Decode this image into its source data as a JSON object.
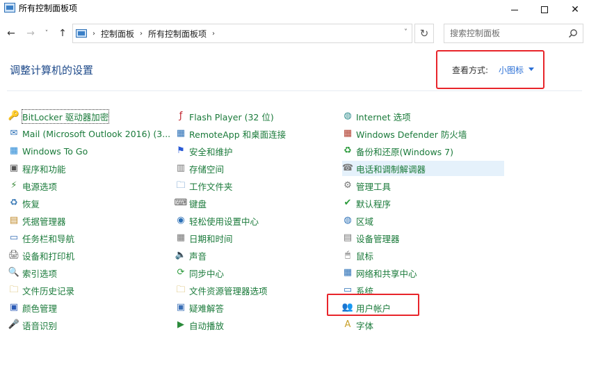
{
  "window": {
    "title": "所有控制面板项",
    "minimize_glyph": "",
    "maximize_glyph": "",
    "close_glyph": "✕"
  },
  "nav": {
    "back_icon": "←",
    "forward_icon": "→",
    "recent_icon": "˅",
    "up_icon": "↑",
    "breadcrumbs": [
      "控制面板",
      "所有控制面板项"
    ],
    "crumb_sep": "›",
    "dropdown_icon": "˅",
    "refresh_icon": "↻",
    "search_placeholder": "搜索控制面板"
  },
  "header": {
    "title": "调整计算机的设置",
    "view_label": "查看方式:",
    "view_value": "小图标"
  },
  "columns": [
    [
      {
        "label": "BitLocker 驱动器加密",
        "icon": "bitlocker-icon",
        "glyph": "🔑",
        "color": "#b08a2a"
      },
      {
        "label": "Mail (Microsoft Outlook 2016) (3...",
        "icon": "mail-icon",
        "glyph": "✉",
        "color": "#2a6fb6"
      },
      {
        "label": "Windows To Go",
        "icon": "windows-to-go-icon",
        "glyph": "▦",
        "color": "#2a8ad6"
      },
      {
        "label": "程序和功能",
        "icon": "programs-icon",
        "glyph": "▣",
        "color": "#555"
      },
      {
        "label": "电源选项",
        "icon": "power-options-icon",
        "glyph": "⚡",
        "color": "#3a8a3a"
      },
      {
        "label": "恢复",
        "icon": "recovery-icon",
        "glyph": "♻",
        "color": "#3a7ab6"
      },
      {
        "label": "凭据管理器",
        "icon": "credential-manager-icon",
        "glyph": "▤",
        "color": "#c08a2a"
      },
      {
        "label": "任务栏和导航",
        "icon": "taskbar-icon",
        "glyph": "▭",
        "color": "#3a6fb6"
      },
      {
        "label": "设备和打印机",
        "icon": "devices-printers-icon",
        "glyph": "🖨",
        "color": "#555"
      },
      {
        "label": "索引选项",
        "icon": "indexing-icon",
        "glyph": "🔍",
        "color": "#777"
      },
      {
        "label": "文件历史记录",
        "icon": "file-history-icon",
        "glyph": "🗀",
        "color": "#c8a02a"
      },
      {
        "label": "颜色管理",
        "icon": "color-management-icon",
        "glyph": "▣",
        "color": "#2a5ab6"
      },
      {
        "label": "语音识别",
        "icon": "speech-icon",
        "glyph": "🎤",
        "color": "#777"
      }
    ],
    [
      {
        "label": "Flash Player (32 位)",
        "icon": "flash-icon",
        "glyph": "ƒ",
        "color": "#c0202a"
      },
      {
        "label": "RemoteApp 和桌面连接",
        "icon": "remoteapp-icon",
        "glyph": "▦",
        "color": "#2a6fb6"
      },
      {
        "label": "安全和维护",
        "icon": "security-flag-icon",
        "glyph": "⚑",
        "color": "#2a5ad6"
      },
      {
        "label": "存储空间",
        "icon": "storage-icon",
        "glyph": "▥",
        "color": "#777"
      },
      {
        "label": "工作文件夹",
        "icon": "work-folders-icon",
        "glyph": "🗀",
        "color": "#2a6fb6"
      },
      {
        "label": "键盘",
        "icon": "keyboard-icon",
        "glyph": "⌨",
        "color": "#555"
      },
      {
        "label": "轻松使用设置中心",
        "icon": "ease-of-access-icon",
        "glyph": "◉",
        "color": "#2a6fb6"
      },
      {
        "label": "日期和时间",
        "icon": "date-time-icon",
        "glyph": "▦",
        "color": "#777"
      },
      {
        "label": "声音",
        "icon": "sound-icon",
        "glyph": "🔈",
        "color": "#777"
      },
      {
        "label": "同步中心",
        "icon": "sync-center-icon",
        "glyph": "⟳",
        "color": "#2a9a3a"
      },
      {
        "label": "文件资源管理器选项",
        "icon": "explorer-options-icon",
        "glyph": "🗀",
        "color": "#c8a02a"
      },
      {
        "label": "疑难解答",
        "icon": "troubleshooting-icon",
        "glyph": "▣",
        "color": "#3a6fb6"
      },
      {
        "label": "自动播放",
        "icon": "autoplay-icon",
        "glyph": "▶",
        "color": "#2a8a3a"
      }
    ],
    [
      {
        "label": "Internet 选项",
        "icon": "internet-options-icon",
        "glyph": "◍",
        "color": "#2a8a8a"
      },
      {
        "label": "Windows Defender 防火墙",
        "icon": "firewall-icon",
        "glyph": "▦",
        "color": "#b03a2a"
      },
      {
        "label": "备份和还原(Windows 7)",
        "icon": "backup-icon",
        "glyph": "♻",
        "color": "#2a9a3a"
      },
      {
        "label": "电话和调制解调器",
        "icon": "phone-modem-icon",
        "glyph": "☎",
        "color": "#777"
      },
      {
        "label": "管理工具",
        "icon": "admin-tools-icon",
        "glyph": "⚙",
        "color": "#777"
      },
      {
        "label": "默认程序",
        "icon": "default-programs-icon",
        "glyph": "✔",
        "color": "#2a9a3a"
      },
      {
        "label": "区域",
        "icon": "region-icon",
        "glyph": "◍",
        "color": "#2a6fb6"
      },
      {
        "label": "设备管理器",
        "icon": "device-manager-icon",
        "glyph": "▤",
        "color": "#777"
      },
      {
        "label": "鼠标",
        "icon": "mouse-icon",
        "glyph": "🖱",
        "color": "#555"
      },
      {
        "label": "网络和共享中心",
        "icon": "network-sharing-icon",
        "glyph": "▦",
        "color": "#2a6fb6"
      },
      {
        "label": "系统",
        "icon": "system-icon",
        "glyph": "▭",
        "color": "#2a6fb6"
      },
      {
        "label": "用户帐户",
        "icon": "user-accounts-icon",
        "glyph": "👥",
        "color": "#8a6a2a"
      },
      {
        "label": "字体",
        "icon": "fonts-icon",
        "glyph": "A",
        "color": "#c8a02a"
      }
    ]
  ],
  "highlighted_item": "电话和调制解调器",
  "focused_item": "BitLocker 驱动器加密",
  "annotations": {
    "box_color": "#e8242a"
  }
}
